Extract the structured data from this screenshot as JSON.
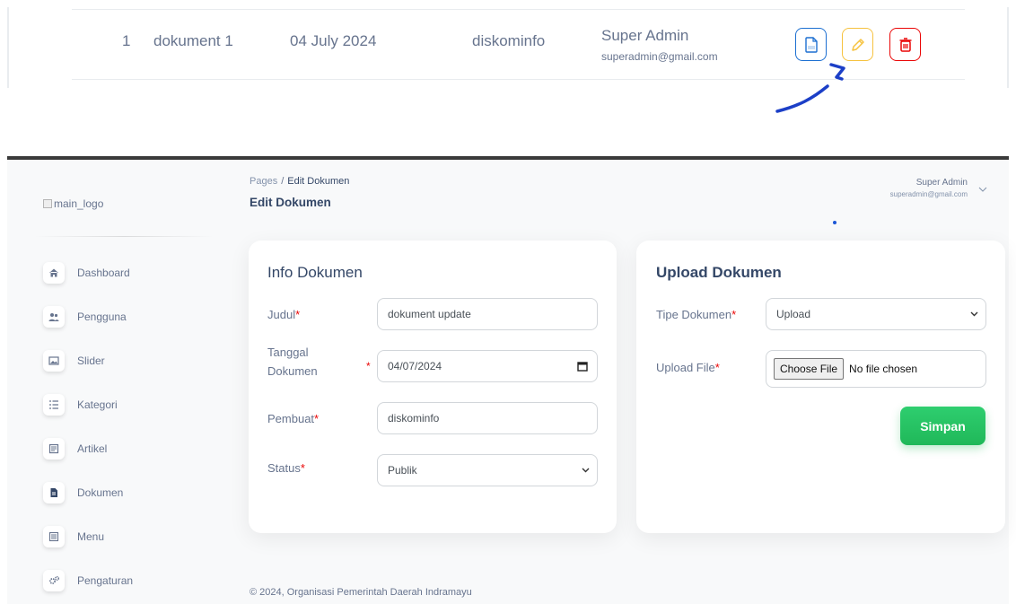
{
  "table_row": {
    "no": "1",
    "name": "dokument 1",
    "date": "04 July 2024",
    "creator": "diskominfo",
    "user_name": "Super Admin",
    "user_email": "superadmin@gmail.com",
    "actions": [
      "pdf-icon",
      "pencil-icon",
      "trash-icon"
    ]
  },
  "logo_alt": "main_logo",
  "sidebar": {
    "items": [
      {
        "label": "Dashboard",
        "icon": "home-icon"
      },
      {
        "label": "Pengguna",
        "icon": "users-icon"
      },
      {
        "label": "Slider",
        "icon": "image-icon"
      },
      {
        "label": "Kategori",
        "icon": "list-icon"
      },
      {
        "label": "Artikel",
        "icon": "article-icon"
      },
      {
        "label": "Dokumen",
        "icon": "document-icon"
      },
      {
        "label": "Menu",
        "icon": "menu-icon"
      },
      {
        "label": "Pengaturan",
        "icon": "cogs-icon"
      }
    ]
  },
  "breadcrumb": {
    "root": "Pages",
    "separator": "/",
    "current": "Edit Dokumen"
  },
  "page_title": "Edit Dokumen",
  "user": {
    "name": "Super Admin",
    "email": "superadmin@gmail.com"
  },
  "info_card": {
    "title": "Info Dokumen",
    "judul_label": "Judul",
    "judul_value": "dokument update",
    "tanggal_label_1": "Tanggal",
    "tanggal_label_2": "Dokumen",
    "tanggal_value": "04/07/2024",
    "pembuat_label": "Pembuat",
    "pembuat_value": "diskominfo",
    "status_label": "Status",
    "status_value": "Publik"
  },
  "upload_card": {
    "title": "Upload Dokumen",
    "tipe_label": "Tipe Dokumen",
    "tipe_value": "Upload",
    "file_label": "Upload File",
    "file_button": "Choose File",
    "file_status": "No file chosen",
    "save_label": "Simpan"
  },
  "required_mark": "*",
  "footer": "© 2024, Organisasi Pemerintah Daerah Indramayu",
  "colors": {
    "primary_text": "#344767",
    "secondary_text": "#67748e",
    "success": "#2dce89",
    "danger": "#ea0606",
    "warning": "#f6c23e",
    "info": "#1c6fd1"
  }
}
